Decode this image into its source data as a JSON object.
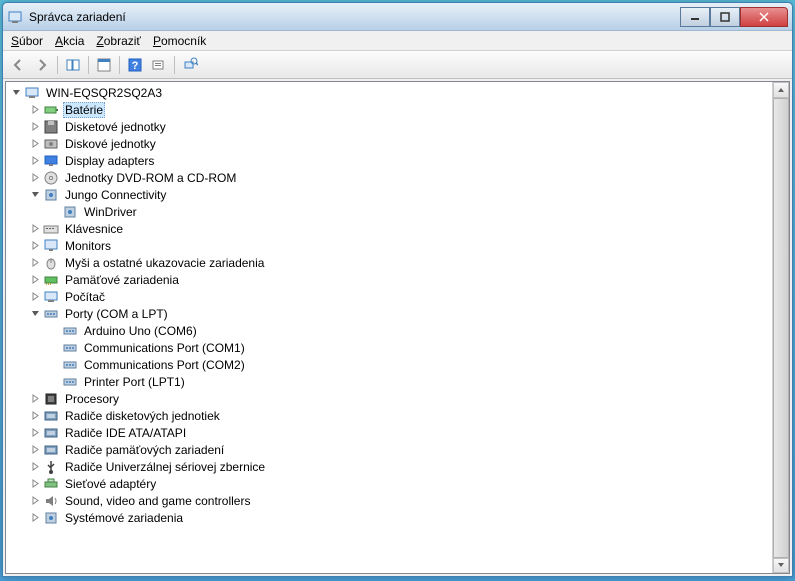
{
  "window": {
    "title": "Správca zariadení"
  },
  "menu": {
    "file": "Súbor",
    "action": "Akcia",
    "view": "Zobraziť",
    "help": "Pomocník"
  },
  "tree": {
    "root": "WIN-EQSQR2SQ2A3",
    "items": [
      {
        "label": "Batérie",
        "expanded": false,
        "selected": true,
        "indent": 1,
        "icon": "battery"
      },
      {
        "label": "Disketové jednotky",
        "expanded": false,
        "indent": 1,
        "icon": "floppy"
      },
      {
        "label": "Diskové jednotky",
        "expanded": false,
        "indent": 1,
        "icon": "disk"
      },
      {
        "label": "Display adapters",
        "expanded": false,
        "indent": 1,
        "icon": "display"
      },
      {
        "label": "Jednotky DVD-ROM a CD-ROM",
        "expanded": false,
        "indent": 1,
        "icon": "dvd"
      },
      {
        "label": "Jungo Connectivity",
        "expanded": true,
        "indent": 1,
        "icon": "system"
      },
      {
        "label": "WinDriver",
        "indent": 2,
        "icon": "system",
        "leaf": true
      },
      {
        "label": "Klávesnice",
        "expanded": false,
        "indent": 1,
        "icon": "keyboard"
      },
      {
        "label": "Monitors",
        "expanded": false,
        "indent": 1,
        "icon": "monitor"
      },
      {
        "label": "Myši a ostatné ukazovacie zariadenia",
        "expanded": false,
        "indent": 1,
        "icon": "mouse"
      },
      {
        "label": "Pamäťové zariadenia",
        "expanded": false,
        "indent": 1,
        "icon": "memory"
      },
      {
        "label": "Počítač",
        "expanded": false,
        "indent": 1,
        "icon": "computer"
      },
      {
        "label": "Porty (COM a LPT)",
        "expanded": true,
        "indent": 1,
        "icon": "port"
      },
      {
        "label": "Arduino Uno (COM6)",
        "indent": 2,
        "icon": "port",
        "leaf": true
      },
      {
        "label": "Communications Port (COM1)",
        "indent": 2,
        "icon": "port",
        "leaf": true
      },
      {
        "label": "Communications Port (COM2)",
        "indent": 2,
        "icon": "port",
        "leaf": true
      },
      {
        "label": "Printer Port (LPT1)",
        "indent": 2,
        "icon": "port",
        "leaf": true
      },
      {
        "label": "Procesory",
        "expanded": false,
        "indent": 1,
        "icon": "cpu"
      },
      {
        "label": "Radiče disketových jednotiek",
        "expanded": false,
        "indent": 1,
        "icon": "controller"
      },
      {
        "label": "Radiče IDE ATA/ATAPI",
        "expanded": false,
        "indent": 1,
        "icon": "controller"
      },
      {
        "label": "Radiče pamäťových zariadení",
        "expanded": false,
        "indent": 1,
        "icon": "controller"
      },
      {
        "label": "Radiče Univerzálnej sériovej zbernice",
        "expanded": false,
        "indent": 1,
        "icon": "usb"
      },
      {
        "label": "Sieťové adaptéry",
        "expanded": false,
        "indent": 1,
        "icon": "network"
      },
      {
        "label": "Sound, video and game controllers",
        "expanded": false,
        "indent": 1,
        "icon": "sound"
      },
      {
        "label": "Systémové zariadenia",
        "expanded": false,
        "indent": 1,
        "icon": "system"
      }
    ]
  }
}
